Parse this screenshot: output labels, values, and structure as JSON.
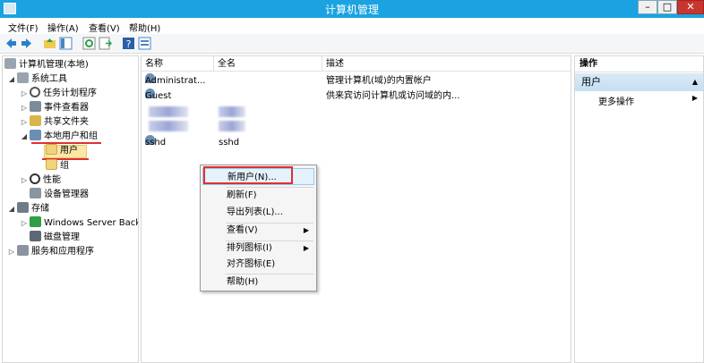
{
  "window": {
    "title": "计算机管理",
    "buttons": {
      "minimize": "–",
      "maximize": "□",
      "close": "✕"
    }
  },
  "menubar": {
    "items": [
      "文件(F)",
      "操作(A)",
      "查看(V)",
      "帮助(H)"
    ]
  },
  "tree": {
    "root": "计算机管理(本地)",
    "items": [
      {
        "label": "系统工具",
        "icon": "tools-icon"
      },
      {
        "label": "任务计划程序",
        "icon": "clock-icon"
      },
      {
        "label": "事件查看器",
        "icon": "event-icon"
      },
      {
        "label": "共享文件夹",
        "icon": "share-icon"
      },
      {
        "label": "本地用户和组",
        "icon": "users-icon"
      },
      {
        "label": "用户",
        "icon": "folder-icon"
      },
      {
        "label": "组",
        "icon": "folder-icon"
      },
      {
        "label": "性能",
        "icon": "performance-icon"
      },
      {
        "label": "设备管理器",
        "icon": "device-icon"
      },
      {
        "label": "存储",
        "icon": "storage-icon"
      },
      {
        "label": "Windows Server Back",
        "icon": "backup-icon"
      },
      {
        "label": "磁盘管理",
        "icon": "disk-icon"
      },
      {
        "label": "服务和应用程序",
        "icon": "services-icon"
      }
    ]
  },
  "list": {
    "columns": [
      "名称",
      "全名",
      "描述"
    ],
    "rows": [
      {
        "name": "Administrat...",
        "fullname": "",
        "description": "管理计算机(域)的内置帐户"
      },
      {
        "name": "Guest",
        "fullname": "",
        "description": "供来宾访问计算机或访问域的内..."
      },
      {
        "name": "sshd",
        "fullname": "sshd",
        "description": ""
      }
    ]
  },
  "context_menu": {
    "items": [
      "新用户(N)...",
      "刷新(F)",
      "导出列表(L)...",
      "查看(V)",
      "排列图标(I)",
      "对齐图标(E)",
      "帮助(H)"
    ]
  },
  "actions": {
    "header": "操作",
    "section": "用户",
    "more": "更多操作"
  }
}
